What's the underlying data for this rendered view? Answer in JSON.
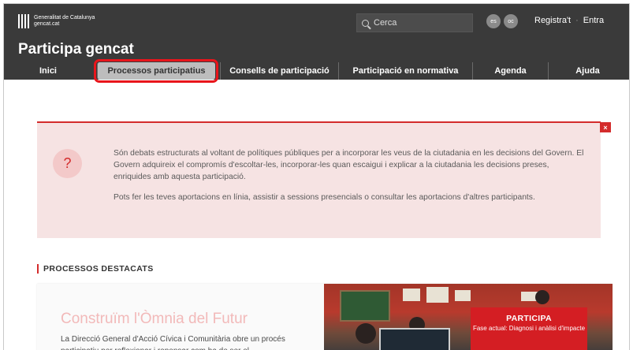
{
  "header": {
    "logo_line1": "Generalitat de Catalunya",
    "logo_line2": "gencat.cat",
    "search_placeholder": "Cerca",
    "languages": [
      "es",
      "oc"
    ],
    "register_label": "Registra't",
    "separator": "·",
    "login_label": "Entra",
    "site_title": "Participa gencat"
  },
  "nav": {
    "items": [
      {
        "label": "Inici"
      },
      {
        "label": "Processos participatius",
        "active": true
      },
      {
        "label": "Consells de participació"
      },
      {
        "label": "Participació en normativa"
      },
      {
        "label": "Agenda"
      },
      {
        "label": "Ajuda"
      }
    ]
  },
  "alert": {
    "close_label": "×",
    "icon_label": "?",
    "paragraph1": "Són debats estructurats al voltant de polítiques públiques per a incorporar les veus de la ciutadania en les decisions del Govern. El Govern adquireix el compromís d'escoltar-les, incorporar-les quan escaigui i explicar a la ciutadania les decisions preses, enriquides amb aquesta participació.",
    "paragraph2": "Pots fer les teves aportacions en línia, assistir a sessions presencials o consultar les aportacions d'altres participants."
  },
  "featured": {
    "section_title": "PROCESSOS DESTACATS",
    "card": {
      "title": "Construïm l'Òmnia del Futur",
      "description": "La Direcció General d'Acció Cívica i Comunitària obre un procés participatiu per reflexionar i repensar com ha de ser el",
      "badge_title": "PARTICIPA",
      "badge_subtitle": "Fase actual: Diagnosi i anàlisi d'impacte"
    }
  },
  "colors": {
    "header_bg": "#3a3a3a",
    "accent_red": "#d42c2c",
    "alert_bg": "#f6e3e3",
    "active_tab_bg": "#bdbdbd",
    "highlight_outline": "#e8151b"
  }
}
